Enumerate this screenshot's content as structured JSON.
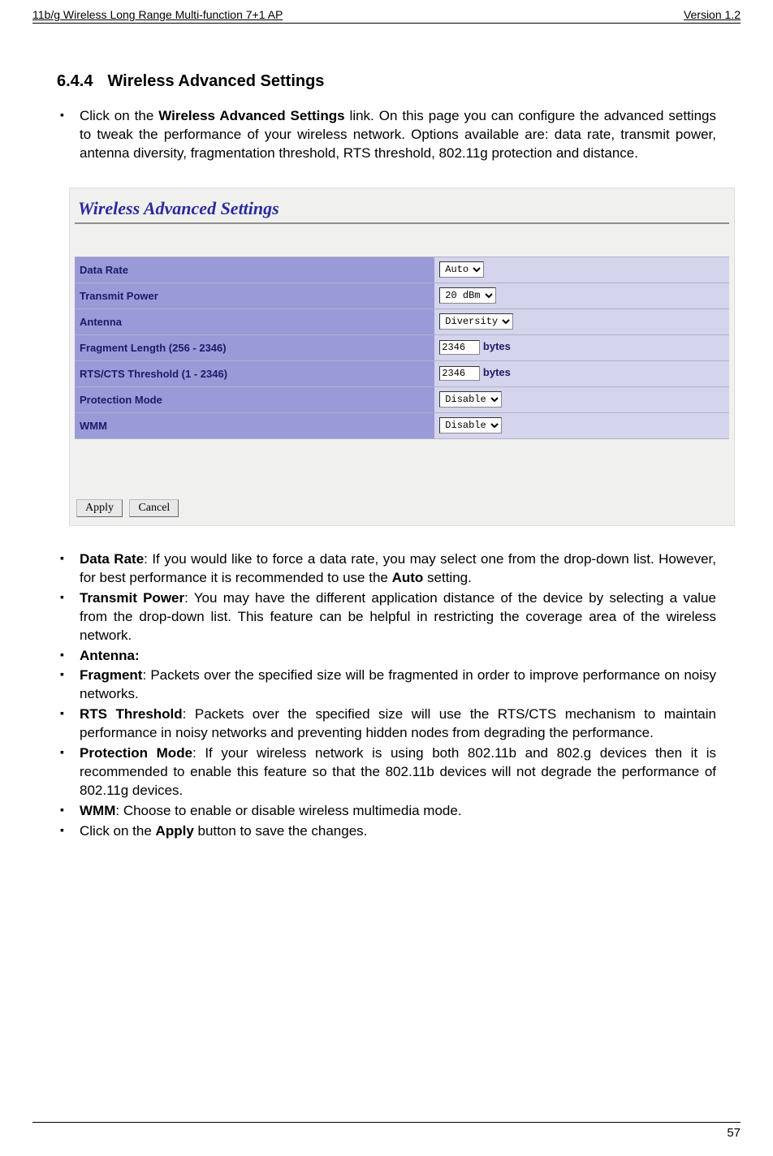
{
  "header": {
    "left": "11b/g Wireless Long Range Multi-function 7+1 AP",
    "right": "Version 1.2"
  },
  "section": {
    "number": "6.4.4",
    "title": "Wireless Advanced Settings"
  },
  "intro": {
    "pre": "Click on the ",
    "bold": "Wireless Advanced Settings",
    "post": " link. On this page you can configure the advanced settings to tweak the performance of your wireless network. Options available are: data rate, transmit power, antenna diversity, fragmentation threshold, RTS threshold, 802.11g protection and distance."
  },
  "screenshot": {
    "title": "Wireless Advanced Settings",
    "rows": [
      {
        "label": "Data Rate",
        "type": "select",
        "value": "Auto"
      },
      {
        "label": "Transmit Power",
        "type": "select",
        "value": "20 dBm"
      },
      {
        "label": "Antenna",
        "type": "select",
        "value": "Diversity"
      },
      {
        "label": "Fragment Length (256 - 2346)",
        "type": "text",
        "value": "2346",
        "suffix": "bytes"
      },
      {
        "label": "RTS/CTS Threshold (1 - 2346)",
        "type": "text",
        "value": "2346",
        "suffix": "bytes"
      },
      {
        "label": "Protection Mode",
        "type": "select",
        "value": "Disable"
      },
      {
        "label": "WMM",
        "type": "select",
        "value": "Disable"
      }
    ],
    "buttons": {
      "apply": "Apply",
      "cancel": "Cancel"
    }
  },
  "bullets": {
    "b1": {
      "bold": "Data Rate",
      "rest": ": If you would like to force a data rate, you may select one from the drop-down list. However, for best performance it is recommended to use the ",
      "bold2": "Auto",
      "rest2": " setting."
    },
    "b2": {
      "bold": "Transmit Power",
      "rest": ": You may have the different application distance of the device by selecting a value from the drop-down list. This feature can be helpful in restricting the coverage area of the wireless network."
    },
    "b3": {
      "bold": "Antenna:"
    },
    "b4": {
      "bold": "Fragment",
      "rest": ": Packets over the specified size will be fragmented in order to improve performance on noisy networks."
    },
    "b5": {
      "bold": "RTS Threshold",
      "rest": ": Packets over the specified size will use the RTS/CTS mechanism to maintain performance in noisy networks and preventing hidden nodes from degrading the performance."
    },
    "b6": {
      "bold": "Protection Mode",
      "rest": ": If your wireless network is using both 802.11b and 802.g devices then it is recommended to enable this feature so that the 802.11b devices will not degrade the performance of 802.11g devices."
    },
    "b7": {
      "bold": "WMM",
      "rest": ": Choose to enable or disable wireless multimedia mode."
    },
    "b8": {
      "pre": "Click on the ",
      "bold": "Apply",
      "rest": " button to save the changes."
    }
  },
  "footer": {
    "page": "57"
  }
}
